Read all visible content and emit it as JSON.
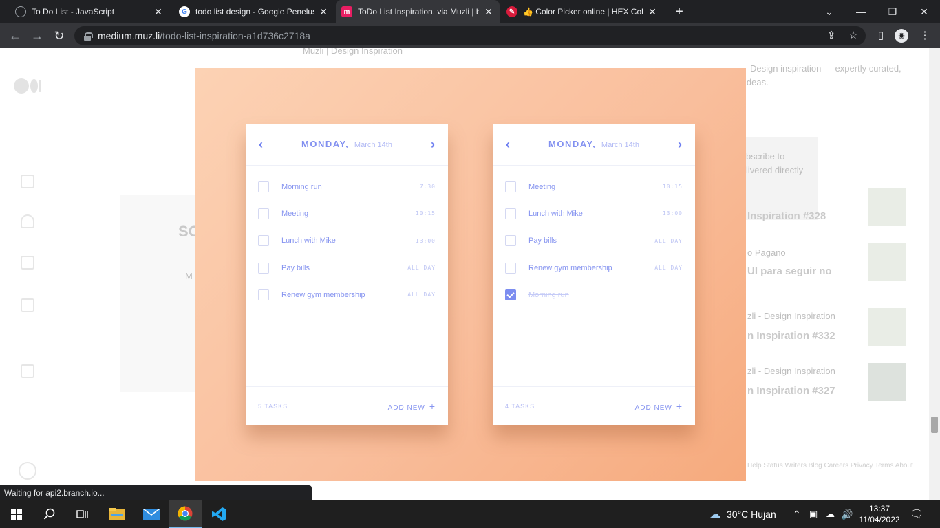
{
  "tabs": [
    {
      "title": "To Do List - JavaScript",
      "icon": "globe-icon"
    },
    {
      "title": "todo list design - Google Penelusuran",
      "icon": "google-icon"
    },
    {
      "title": "ToDo List Inspiration. via Muzli | by Muzli",
      "icon": "muzli-icon"
    },
    {
      "title": "👍 Color Picker online | HEX Color Picker",
      "icon": "color-picker-icon"
    }
  ],
  "toolbar": {
    "url_host": "medium.muz.li",
    "url_path": "/todo-list-inspiration-a1d736c2718a"
  },
  "background": {
    "byline": "Muzli | Design Inspiration",
    "blurb_1": "Design inspiration — expertly curated,",
    "blurb_2": "ideas.",
    "subscribe_1": "bscribe to",
    "subscribe_2": "livered directly",
    "post_1": "Inspiration #328",
    "post_2_author": "o Pagano",
    "post_2": "UI para seguir no",
    "post_3_author": "zli - Design Inspiration",
    "post_3": "n Inspiration #332",
    "post_4_author": "zli - Design Inspiration",
    "post_4": "n Inspiration #327",
    "footer": "Help  Status  Writers  Blog  Careers  Privacy  Terms  About",
    "left_letters": "SO"
  },
  "cards": [
    {
      "day": "MONDAY,",
      "date": "March 14th",
      "tasks": [
        {
          "name": "Morning run",
          "time": "7:30",
          "done": false
        },
        {
          "name": "Meeting",
          "time": "10:15",
          "done": false
        },
        {
          "name": "Lunch with Mike",
          "time": "13:00",
          "done": false
        },
        {
          "name": "Pay bills",
          "time": "ALL DAY",
          "done": false
        },
        {
          "name": "Renew gym membership",
          "time": "ALL DAY",
          "done": false
        }
      ],
      "count": "5 TASKS",
      "add_new": "ADD NEW"
    },
    {
      "day": "MONDAY,",
      "date": "March 14th",
      "tasks": [
        {
          "name": "Meeting",
          "time": "10:15",
          "done": false
        },
        {
          "name": "Lunch with Mike",
          "time": "13:00",
          "done": false
        },
        {
          "name": "Pay bills",
          "time": "ALL DAY",
          "done": false
        },
        {
          "name": "Renew gym membership",
          "time": "ALL DAY",
          "done": false
        },
        {
          "name": "Morning run",
          "time": "",
          "done": true
        }
      ],
      "count": "4 TASKS",
      "add_new": "ADD NEW"
    }
  ],
  "status_text": "Waiting for api2.branch.io...",
  "taskbar": {
    "weather": "30°C  Hujan",
    "time": "13:37",
    "date": "11/04/2022"
  },
  "colors": {
    "accent": "#8694f0",
    "hero_start": "#fcd2b4",
    "hero_end": "#f6aa7d"
  }
}
